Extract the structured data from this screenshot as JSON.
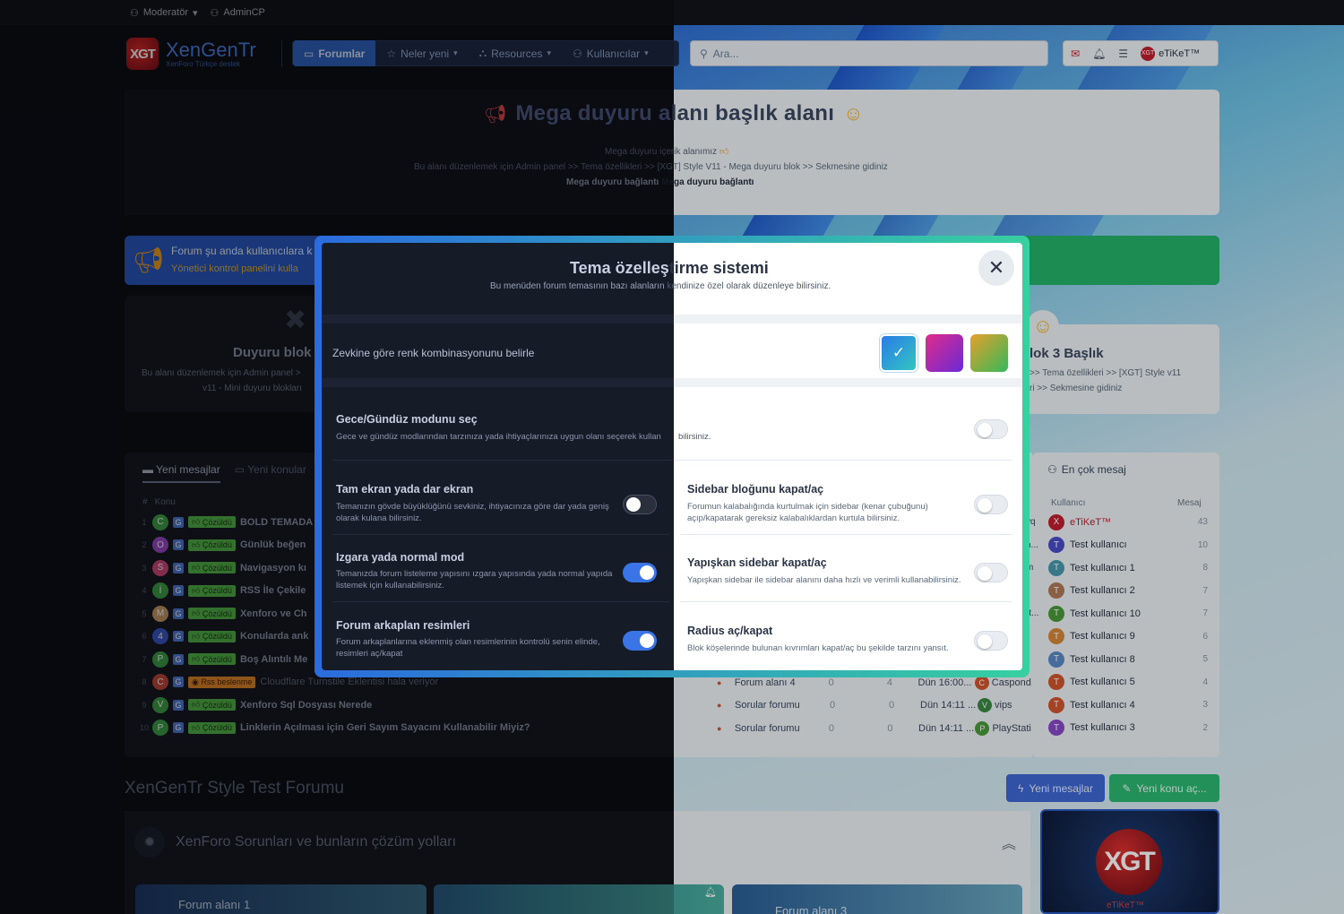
{
  "modbar": {
    "moderator": "Moderatör",
    "admincp": "AdminCP"
  },
  "header": {
    "logo_mark": "XGT",
    "logo_text": "XenGenTr",
    "logo_sub": "XenForo Türkçe destek",
    "nav": [
      "Forumlar",
      "Neler yeni",
      "Resources",
      "Kullanıcılar"
    ],
    "search_placeholder": "Ara...",
    "user": "eTiKeT™"
  },
  "mega": {
    "title_left": "Mega duyuru a",
    "title_right": "lanı başlık alanı",
    "line1": "Mega duyuru içerik alanımız",
    "line2_left": "Bu alanı düzenlemek için Admin panel >> Tema özellikleri >> ",
    "line2_right": "[XGT] Style V11 - Mega duyuru blok >> Sekmesine gidiniz",
    "link1": "Mega duyuru bağlantı",
    "link2": "Mega duyuru bağlantı"
  },
  "notice": {
    "line1": "Forum şu anda kullanıcılara k",
    "line2": "Yönetici kontrol panelini kulla"
  },
  "blocks": {
    "left_title": "Duyuru blok",
    "left_desc1": "Bu alanı düzenlemek için Admin panel >",
    "left_desc2": "v11 - Mini duyuru blokları",
    "right_title": "lok 3 Başlık",
    "right_desc1": ">> Tema özellikleri >> [XGT] Style v11",
    "right_desc2": "ri >> Sekmesine gidiniz"
  },
  "latest": {
    "tab1": "Yeni mesajlar",
    "tab2": "Yeni konular",
    "col_hash": "#",
    "col_topic": "Konu",
    "rows": [
      {
        "n": "1",
        "av": "C",
        "avc": "#3fa24a",
        "badge": "Çözüldü",
        "title": "BOLD TEMADA",
        "or": false
      },
      {
        "n": "2",
        "av": "O",
        "avc": "#9b4bc9",
        "badge": "Çözüldü",
        "title": "Günlük beğen",
        "or": false
      },
      {
        "n": "3",
        "av": "S",
        "avc": "#d24a7b",
        "badge": "Çözüldü",
        "title": "Navigasyon kı",
        "or": false
      },
      {
        "n": "4",
        "av": "İ",
        "avc": "#3fa24a",
        "badge": "Çözüldü",
        "title": "RSS İle Çekile",
        "or": false
      },
      {
        "n": "5",
        "av": "M",
        "avc": "#c99a6a",
        "badge": "Çözüldü",
        "title": "Xenforo ve Ch",
        "or": false
      },
      {
        "n": "6",
        "av": "4",
        "avc": "#3b57c9",
        "badge": "Çözüldü",
        "title": "Konularda ank",
        "or": false
      },
      {
        "n": "7",
        "av": "P",
        "avc": "#3fa24a",
        "badge": "Çözüldü",
        "title": "Boş Alıntılı Me",
        "or": false
      },
      {
        "n": "8",
        "av": "C",
        "avc": "#c24a3a",
        "badge": "Rss beslenme",
        "title": "Cloudflare Turnstile Eklentisi hala veriyor",
        "or": true
      },
      {
        "n": "9",
        "av": "V",
        "avc": "#3fa24a",
        "badge": "Çözüldü",
        "title": "Xenforo Sql Dosyası Nerede",
        "or": false
      },
      {
        "n": "10",
        "av": "P",
        "avc": "#3fa24a",
        "badge": "Çözüldü",
        "title": "Linklerin Açılması için Geri Sayım Sayacını Kullanabilir Miyiz?",
        "or": false
      }
    ]
  },
  "forumrows": [
    {
      "forum": "Forum alanı 4",
      "a": "0",
      "b": "4",
      "date": "Dün 16:00...",
      "av": "C",
      "avc": "#d2562e",
      "user": "Caspond..."
    },
    {
      "forum": "Sorular forumu",
      "a": "0",
      "b": "0",
      "date": "Dün 14:11 ...",
      "av": "V",
      "avc": "#3b8a45",
      "user": "vips"
    },
    {
      "forum": "Sorular forumu",
      "a": "0",
      "b": "0",
      "date": "Dün 14:11 ...",
      "av": "P",
      "avc": "#4a9b3a",
      "user": "PlayStati..."
    }
  ],
  "topposters": {
    "title": "En çok mesaj",
    "col_user": "Kullanıcı",
    "col_msg": "Mesaj",
    "rows": [
      {
        "av": "X",
        "avc": "#c21f2f",
        "name": "eTiKeT™",
        "count": "43",
        "red": true
      },
      {
        "av": "T",
        "avc": "#4b4ec9",
        "name": "Test kullanıcı",
        "count": "10"
      },
      {
        "av": "T",
        "avc": "#4a9ab0",
        "name": "Test kullanıcı 1",
        "count": "8"
      },
      {
        "av": "T",
        "avc": "#b07a5a",
        "name": "Test kullanıcı 2",
        "count": "7"
      },
      {
        "av": "T",
        "avc": "#4a9b3a",
        "name": "Test kullanıcı 10",
        "count": "7"
      },
      {
        "av": "T",
        "avc": "#d98a3a",
        "name": "Test kullanıcı 9",
        "count": "6"
      },
      {
        "av": "T",
        "avc": "#5a8ac9",
        "name": "Test kullanıcı 8",
        "count": "5"
      },
      {
        "av": "T",
        "avc": "#d2562e",
        "name": "Test kullanıcı 5",
        "count": "4"
      },
      {
        "av": "T",
        "avc": "#d2562e",
        "name": "Test kullanıcı 4",
        "count": "3"
      },
      {
        "av": "T",
        "avc": "#8a4ac9",
        "name": "Test kullanıcı 3",
        "count": "2"
      }
    ],
    "partial": [
      "vq",
      "n...",
      "m",
      "",
      "rt...",
      "",
      "",
      "",
      "",
      ""
    ]
  },
  "bottom": {
    "section_title": "XenGenTr Style Test Forumu",
    "btn_new_posts": "Yeni mesajlar",
    "btn_new_thread": "Yeni konu aç...",
    "category": "XenForo Sorunları ve bunların çözüm yolları",
    "forum1": "Forum alanı 1",
    "forum3": "Forum alanı 3",
    "logo_user": "eTiKeT™"
  },
  "modal": {
    "title_left": "Tema özelleş",
    "title_right": "tirme sistemi",
    "subtitle_left": "Bu menüden forum temasının bazı alanların",
    "subtitle_right": " kendinize özel olarak düzenleye bilirsiniz.",
    "color_label": "Zevkine göre renk kombinasyonunu belirle",
    "night_title": "Gece/Gündüz modunu seç",
    "night_desc_left": "Gece ve gündüz modlarından tarzınıza yada ihtiyaçlarınıza uygun olanı seçerek kullan",
    "night_desc_right": "bilirsiniz.",
    "full_title": "Tam ekran yada dar ekran",
    "full_desc": "Temanızın gövde büyüklüğünü sevkiniz, ihtiyacınıza göre dar yada geniş olarak kulana bilirsiniz.",
    "grid_title": "Izgara yada normal mod",
    "grid_desc": "Temanızda forum listeleme yapısını ızgara yapısında yada normal yapıda listemek için kullanabilirsiniz.",
    "bg_title": "Forum arkaplan resimleri",
    "bg_desc": "Forum arkaplanlarına eklenmiş olan resimlerinin kontrolü senin elinde, resimleri aç/kapat",
    "sidebar_title": "Sidebar bloğunu kapat/aç",
    "sidebar_desc": "Forumun kalabalığında kurtulmak için sidebar (kenar çubuğunu) açıp/kapatarak gereksiz kalabalıklardan kurtula bilirsiniz.",
    "sticky_title": "Yapışkan sidebar kapat/aç",
    "sticky_desc": "Yapışkan sidebar ile sidebar alanını daha hızlı ve verimli kullanabilirsiniz.",
    "radius_title": "Radius aç/kapat",
    "radius_desc": "Blok köşelerinde bulunan kıvrımları kapat/aç bu şekilde tarzını yansıt.",
    "toggles": {
      "night": false,
      "full": false,
      "grid": true,
      "bg": true,
      "sidebar": false,
      "sticky": false,
      "radius": false
    }
  },
  "colors": {
    "accent": "#3a74e6",
    "border_start": "#2b6bde",
    "border_end": "#37d0a0"
  }
}
